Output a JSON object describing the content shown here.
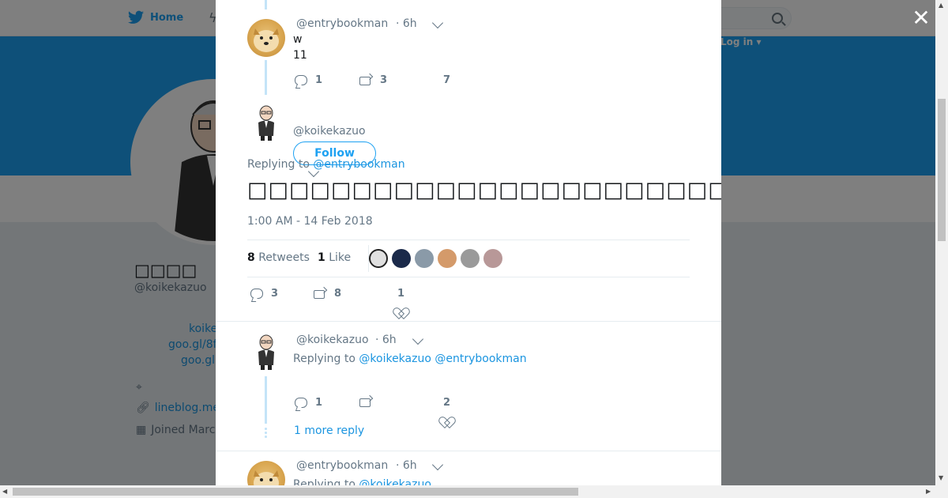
{
  "nav": {
    "home_label": "Home",
    "login_label": "Log in ▾"
  },
  "profile": {
    "name": "□□□□",
    "handle": "@koikekazuo",
    "bio_link1": "koike",
    "bio_link2": "goo.gl/8f",
    "bio_link3": "goo.gl",
    "website": "lineblog.me",
    "joined": "Joined Marc"
  },
  "thread": [
    {
      "handle": "@entrybookman",
      "time": "· 6h",
      "lines": [
        "w",
        "11"
      ],
      "replies": "1",
      "retweets": "3",
      "likes": "7"
    }
  ],
  "main_tweet": {
    "handle": "@koikekazuo",
    "follow_label": "Follow",
    "replying_prefix": "Replying to ",
    "replying_to": "@entrybookman",
    "text": "□□□□□□□□□□□□□□□□□□□□□□□□□□□□□□□□□□□□□□□□□□□□□□□□□□",
    "timestamp": "1:00 AM - 14 Feb 2018",
    "retweets_count": "8",
    "retweets_label": "Retweets",
    "likes_count": "1",
    "likes_label": "Like",
    "replies": "3",
    "rt": "8",
    "likes": "1"
  },
  "reply_tweet": {
    "handle": "@koikekazuo",
    "time": "· 6h",
    "replying_prefix": "Replying to ",
    "replying_to_1": "@koikekazuo",
    "replying_to_2": "@entrybookman",
    "replies": "1",
    "likes": "2",
    "more_reply": "1 more reply"
  },
  "last_tweet": {
    "handle": "@entrybookman",
    "time": "· 6h",
    "replying_prefix": "Replying to ",
    "replying_to": "@koikekazuo"
  },
  "colors": {
    "accent": "#1da1f2",
    "banner": "#1da1f2",
    "link": "#1b95e0"
  }
}
